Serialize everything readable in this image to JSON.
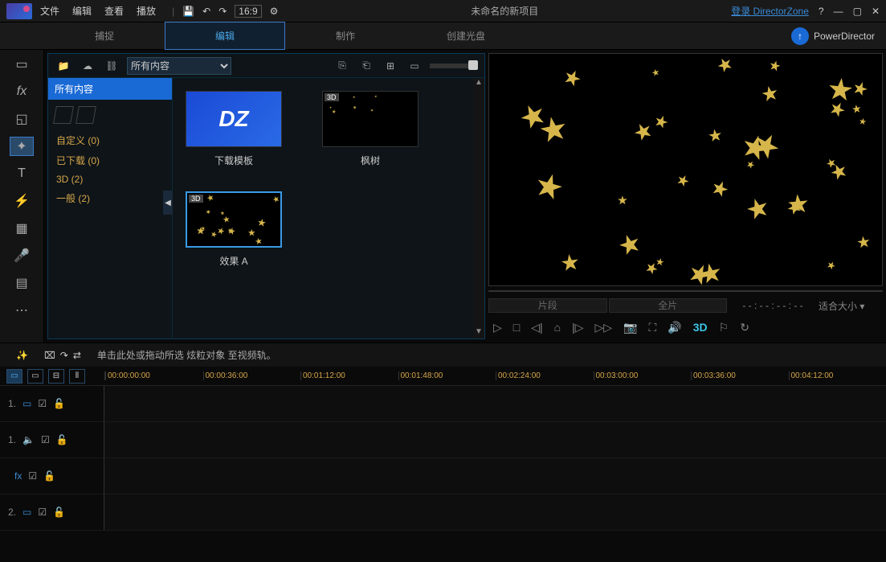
{
  "title": "未命名的新项目",
  "menu": [
    "文件",
    "编辑",
    "查看",
    "播放"
  ],
  "login_link": "登录 DirectorZone",
  "brand": "PowerDirector",
  "aspect_label": "16:9",
  "tabs": [
    {
      "label": "捕捉",
      "active": false
    },
    {
      "label": "编辑",
      "active": true
    },
    {
      "label": "制作",
      "active": false
    },
    {
      "label": "创建光盘",
      "active": false
    }
  ],
  "filter_select": "所有内容",
  "sidebar_head": "所有内容",
  "categories": [
    {
      "label": "自定义",
      "count": "(0)"
    },
    {
      "label": "已下载",
      "count": "(0)"
    },
    {
      "label": "3D",
      "count": "(2)"
    },
    {
      "label": "一般",
      "count": "(2)"
    }
  ],
  "thumbs": [
    {
      "label": "下载模板",
      "type": "dz",
      "badge": "",
      "selected": false
    },
    {
      "label": "枫树",
      "type": "dark",
      "badge": "3D",
      "selected": false
    },
    {
      "label": "效果 A",
      "type": "stars",
      "badge": "3D",
      "selected": true
    }
  ],
  "preview_segments": [
    "片段",
    "全片"
  ],
  "preview_time": "- - : - - : - - : - -",
  "preview_fit": "适合大小 ▾",
  "preview_3d": "3D",
  "timeline_hint": "单击此处或拖动所选 炫粒对象 至视频轨。",
  "timeline_ticks": [
    "00:00:00:00",
    "00:00:36:00",
    "00:01:12:00",
    "00:01:48:00",
    "00:02:24:00",
    "00:03:00:00",
    "00:03:36:00",
    "00:04:12:00"
  ],
  "tracks": [
    {
      "num": "1.",
      "icon": "▭",
      "type": "video"
    },
    {
      "num": "1.",
      "icon": "🔈",
      "type": "audio"
    },
    {
      "num": "",
      "icon": "fx",
      "type": "fx"
    },
    {
      "num": "2.",
      "icon": "▭",
      "type": "video"
    }
  ]
}
